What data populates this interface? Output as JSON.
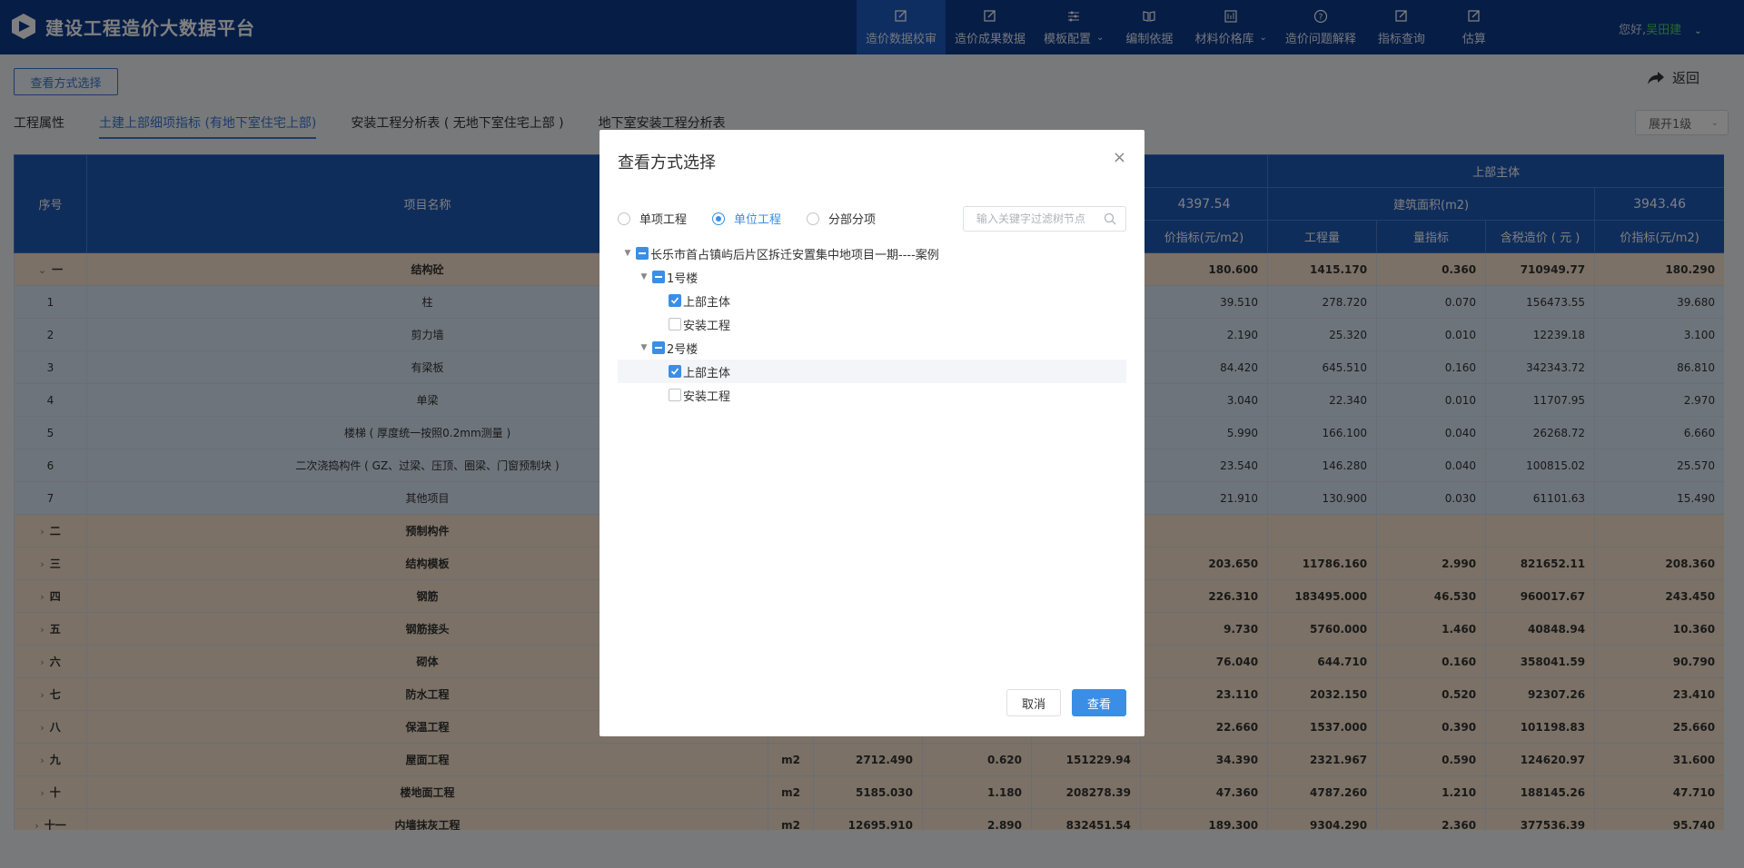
{
  "header": {
    "brand": "建设工程造价大数据平台",
    "nav": [
      {
        "label": "造价数据校审",
        "active": true,
        "caret": false
      },
      {
        "label": "造价成果数据",
        "active": false,
        "caret": false
      },
      {
        "label": "模板配置",
        "active": false,
        "caret": true
      },
      {
        "label": "编制依据",
        "active": false,
        "caret": false
      },
      {
        "label": "材料价格库",
        "active": false,
        "caret": true
      },
      {
        "label": "造价问题解释",
        "active": false,
        "caret": false
      },
      {
        "label": "指标查询",
        "active": false,
        "caret": false
      },
      {
        "label": "估算",
        "active": false,
        "caret": false
      }
    ],
    "greeting": "您好,",
    "username": "吴田建"
  },
  "toolbar": {
    "view_mode_button": "查看方式选择",
    "back_label": "返回",
    "expand_label": "展开1级"
  },
  "tabs": [
    {
      "label": "工程属性",
      "active": false
    },
    {
      "label": "土建上部细项指标 (有地下室住宅上部)",
      "active": true
    },
    {
      "label": "安装工程分析表 ( 无地下室住宅上部 )",
      "active": false
    },
    {
      "label": "地下室安装工程分析表",
      "active": false
    }
  ],
  "table": {
    "headers": {
      "seq": "序号",
      "name": "项目名称",
      "group_top": "上部主体",
      "area_label": "建筑面积(m2)",
      "left_area_value": "4397.54",
      "right_area_value": "3943.46",
      "price_index": "价指标(元/m2)",
      "quantity": "工程量",
      "qty_index": "量指标",
      "tax_cost": "含税造价 ( 元 )"
    },
    "rows": [
      {
        "type": "cat",
        "expanded": true,
        "seq": "一",
        "name": "结构砼",
        "unit": "",
        "q1": "",
        "i1": "",
        "c1": "",
        "p1": "180.600",
        "q2": "1415.170",
        "i2": "0.360",
        "c2": "710949.77",
        "p2": "180.290"
      },
      {
        "type": "child",
        "seq": "1",
        "name": "柱",
        "unit": "",
        "q1": "",
        "i1": "",
        "c1": "",
        "p1": "39.510",
        "q2": "278.720",
        "i2": "0.070",
        "c2": "156473.55",
        "p2": "39.680"
      },
      {
        "type": "child",
        "seq": "2",
        "name": "剪力墙",
        "unit": "",
        "q1": "",
        "i1": "",
        "c1": "",
        "p1": "2.190",
        "q2": "25.320",
        "i2": "0.010",
        "c2": "12239.18",
        "p2": "3.100"
      },
      {
        "type": "child",
        "seq": "3",
        "name": "有梁板",
        "unit": "",
        "q1": "",
        "i1": "",
        "c1": "",
        "p1": "84.420",
        "q2": "645.510",
        "i2": "0.160",
        "c2": "342343.72",
        "p2": "86.810"
      },
      {
        "type": "child",
        "seq": "4",
        "name": "单梁",
        "unit": "",
        "q1": "",
        "i1": "",
        "c1": "",
        "p1": "3.040",
        "q2": "22.340",
        "i2": "0.010",
        "c2": "11707.95",
        "p2": "2.970"
      },
      {
        "type": "child",
        "seq": "5",
        "name": "楼梯 ( 厚度统一按照0.2mm测量 )",
        "unit": "",
        "q1": "",
        "i1": "",
        "c1": "",
        "p1": "5.990",
        "q2": "166.100",
        "i2": "0.040",
        "c2": "26268.72",
        "p2": "6.660"
      },
      {
        "type": "child",
        "seq": "6",
        "name": "二次浇捣构件 ( GZ、过梁、压顶、圈梁、门窗预制块 )",
        "unit": "",
        "q1": "",
        "i1": "",
        "c1": "",
        "p1": "23.540",
        "q2": "146.280",
        "i2": "0.040",
        "c2": "100815.02",
        "p2": "25.570"
      },
      {
        "type": "child",
        "seq": "7",
        "name": "其他项目",
        "unit": "",
        "q1": "",
        "i1": "",
        "c1": "",
        "p1": "21.910",
        "q2": "130.900",
        "i2": "0.030",
        "c2": "61101.63",
        "p2": "15.490"
      },
      {
        "type": "cat",
        "expanded": false,
        "seq": "二",
        "name": "预制构件",
        "unit": "",
        "q1": "",
        "i1": "",
        "c1": "",
        "p1": "",
        "q2": "",
        "i2": "",
        "c2": "",
        "p2": ""
      },
      {
        "type": "cat",
        "expanded": false,
        "seq": "三",
        "name": "结构模板",
        "unit": "",
        "q1": "",
        "i1": "",
        "c1": "",
        "p1": "203.650",
        "q2": "11786.160",
        "i2": "2.990",
        "c2": "821652.11",
        "p2": "208.360"
      },
      {
        "type": "cat",
        "expanded": false,
        "seq": "四",
        "name": "钢筋",
        "unit": "",
        "q1": "",
        "i1": "",
        "c1": "",
        "p1": "226.310",
        "q2": "183495.000",
        "i2": "46.530",
        "c2": "960017.67",
        "p2": "243.450"
      },
      {
        "type": "cat",
        "expanded": false,
        "seq": "五",
        "name": "钢筋接头",
        "unit": "",
        "q1": "",
        "i1": "",
        "c1": "",
        "p1": "9.730",
        "q2": "5760.000",
        "i2": "1.460",
        "c2": "40848.94",
        "p2": "10.360"
      },
      {
        "type": "cat",
        "expanded": false,
        "seq": "六",
        "name": "砌体",
        "unit": "",
        "q1": "",
        "i1": "",
        "c1": "",
        "p1": "76.040",
        "q2": "644.710",
        "i2": "0.160",
        "c2": "358041.59",
        "p2": "90.790"
      },
      {
        "type": "cat",
        "expanded": false,
        "seq": "七",
        "name": "防水工程",
        "unit": "",
        "q1": "",
        "i1": "",
        "c1": "",
        "p1": "23.110",
        "q2": "2032.150",
        "i2": "0.520",
        "c2": "92307.26",
        "p2": "23.410"
      },
      {
        "type": "cat",
        "expanded": false,
        "seq": "八",
        "name": "保温工程",
        "unit": "",
        "q1": "",
        "i1": "",
        "c1": "",
        "p1": "22.660",
        "q2": "1537.000",
        "i2": "0.390",
        "c2": "101198.83",
        "p2": "25.660"
      },
      {
        "type": "cat",
        "expanded": false,
        "seq": "九",
        "name": "屋面工程",
        "unit": "m2",
        "q1": "2712.490",
        "i1": "0.620",
        "c1": "151229.94",
        "p1": "34.390",
        "q2": "2321.967",
        "i2": "0.590",
        "c2": "124620.97",
        "p2": "31.600"
      },
      {
        "type": "cat",
        "expanded": false,
        "seq": "十",
        "name": "楼地面工程",
        "unit": "m2",
        "q1": "5185.030",
        "i1": "1.180",
        "c1": "208278.39",
        "p1": "47.360",
        "q2": "4787.260",
        "i2": "1.210",
        "c2": "188145.26",
        "p2": "47.710"
      },
      {
        "type": "cat",
        "expanded": false,
        "seq": "十一",
        "name": "内墙抹灰工程",
        "unit": "m2",
        "q1": "12695.910",
        "i1": "2.890",
        "c1": "832451.54",
        "p1": "189.300",
        "q2": "9304.290",
        "i2": "2.360",
        "c2": "377536.39",
        "p2": "95.740"
      }
    ]
  },
  "modal": {
    "title": "查看方式选择",
    "close_icon": "×",
    "radios": [
      {
        "label": "单项工程",
        "checked": false
      },
      {
        "label": "单位工程",
        "checked": true
      },
      {
        "label": "分部分项",
        "checked": false
      }
    ],
    "search_placeholder": "输入关键字过滤树节点",
    "tree": [
      {
        "level": 0,
        "label": "长乐市首占镇屿后片区拆迁安置集中地项目一期----案例",
        "state": "partial",
        "caret": true,
        "highlight": false
      },
      {
        "level": 1,
        "label": "1号楼",
        "state": "partial",
        "caret": true,
        "highlight": false
      },
      {
        "level": 2,
        "label": "上部主体",
        "state": "checked",
        "caret": false,
        "highlight": false
      },
      {
        "level": 2,
        "label": "安装工程",
        "state": "unchecked",
        "caret": false,
        "highlight": false
      },
      {
        "level": 1,
        "label": "2号楼",
        "state": "partial",
        "caret": true,
        "highlight": false
      },
      {
        "level": 2,
        "label": "上部主体",
        "state": "checked",
        "caret": false,
        "highlight": true
      },
      {
        "level": 2,
        "label": "安装工程",
        "state": "unchecked",
        "caret": false,
        "highlight": false
      }
    ],
    "cancel_label": "取消",
    "ok_label": "查看"
  },
  "colors": {
    "topbar": "#0d3a8c",
    "nav_active": "#1d5bc2",
    "table_header": "#1f5ab6",
    "category_row": "#f6e3cd",
    "child_row": "#dde9f7",
    "accent": "#3a8ee6",
    "username": "#4fd35e"
  }
}
